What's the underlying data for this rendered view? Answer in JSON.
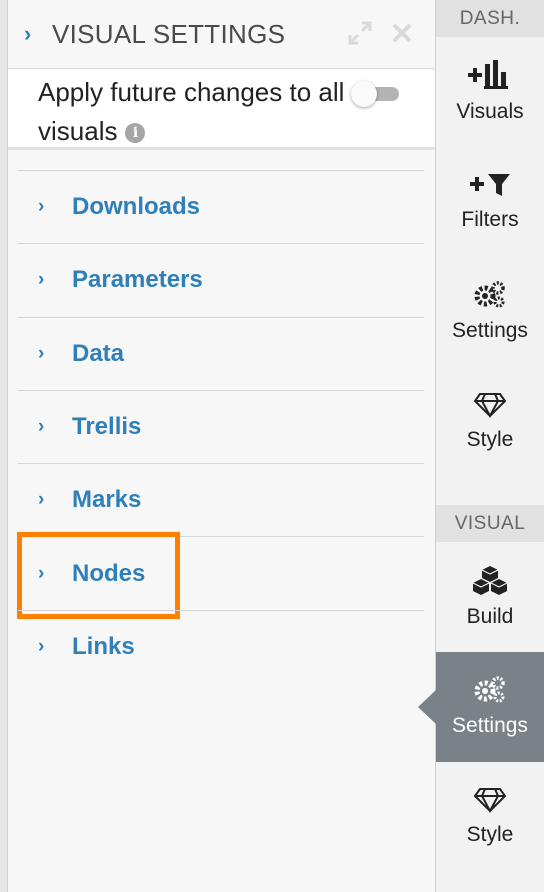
{
  "panel": {
    "title": "VISUAL SETTINGS",
    "apply_label": "Apply future changes to all visuals",
    "apply_toggle_on": false
  },
  "sections": [
    {
      "label": "Downloads"
    },
    {
      "label": "Parameters"
    },
    {
      "label": "Data"
    },
    {
      "label": "Trellis"
    },
    {
      "label": "Marks"
    },
    {
      "label": "Nodes"
    },
    {
      "label": "Links"
    }
  ],
  "sidebar": {
    "dash_group": "DASH.",
    "visual_group": "VISUAL",
    "dash_items": [
      {
        "label": "Visuals",
        "icon": "add-chart-icon"
      },
      {
        "label": "Filters",
        "icon": "add-filter-icon"
      },
      {
        "label": "Settings",
        "icon": "gears-icon"
      },
      {
        "label": "Style",
        "icon": "diamond-icon"
      }
    ],
    "visual_items": [
      {
        "label": "Build",
        "icon": "cubes-icon"
      },
      {
        "label": "Settings",
        "icon": "gears-icon",
        "active": true
      },
      {
        "label": "Style",
        "icon": "diamond-icon"
      }
    ]
  },
  "colors": {
    "accent": "#2f7fb9",
    "highlight": "#ff8000",
    "active_nav": "#7b8287"
  }
}
